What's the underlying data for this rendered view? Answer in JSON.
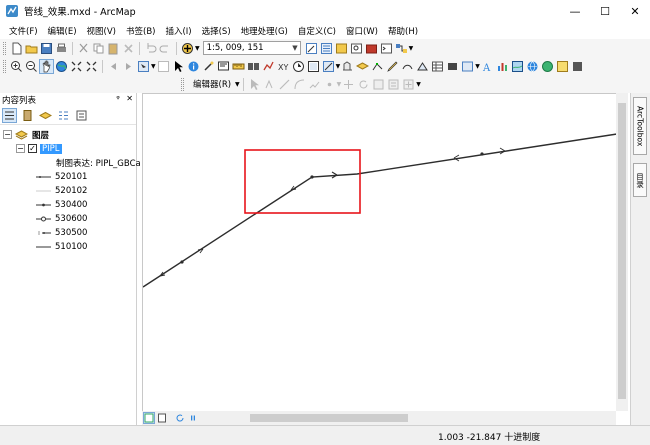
{
  "window": {
    "title": "管线_效果.mxd - ArcMap",
    "minimize_glyph": "—",
    "maximize_glyph": "☐",
    "close_glyph": "✕"
  },
  "menu": [
    "文件(F)",
    "编辑(E)",
    "视图(V)",
    "书签(B)",
    "插入(I)",
    "选择(S)",
    "地理处理(G)",
    "自定义(C)",
    "窗口(W)",
    "帮助(H)"
  ],
  "toolbar": {
    "scale_value": "1:5, 009, 151",
    "editor_label": "编辑器(R)"
  },
  "toc": {
    "title": "内容列表",
    "pin_glyph": "ᵠ",
    "close_glyph": "✕",
    "group_label": "图层",
    "layer_name": "PIPL",
    "representation_label": "制图表达: PIPL_GBCa",
    "classes": [
      "520101",
      "520102",
      "530400",
      "530600",
      "530500",
      "510100"
    ]
  },
  "right_dock": {
    "arctoolbox_label": "ArcToolbox",
    "catalog_label": "目录"
  },
  "status": {
    "coordinates": "1.003  -21.847 十进制度"
  },
  "colors": {
    "highlight_box": "#e8141b",
    "line": "#2d2d2d",
    "selection_blue": "#3399ff"
  }
}
